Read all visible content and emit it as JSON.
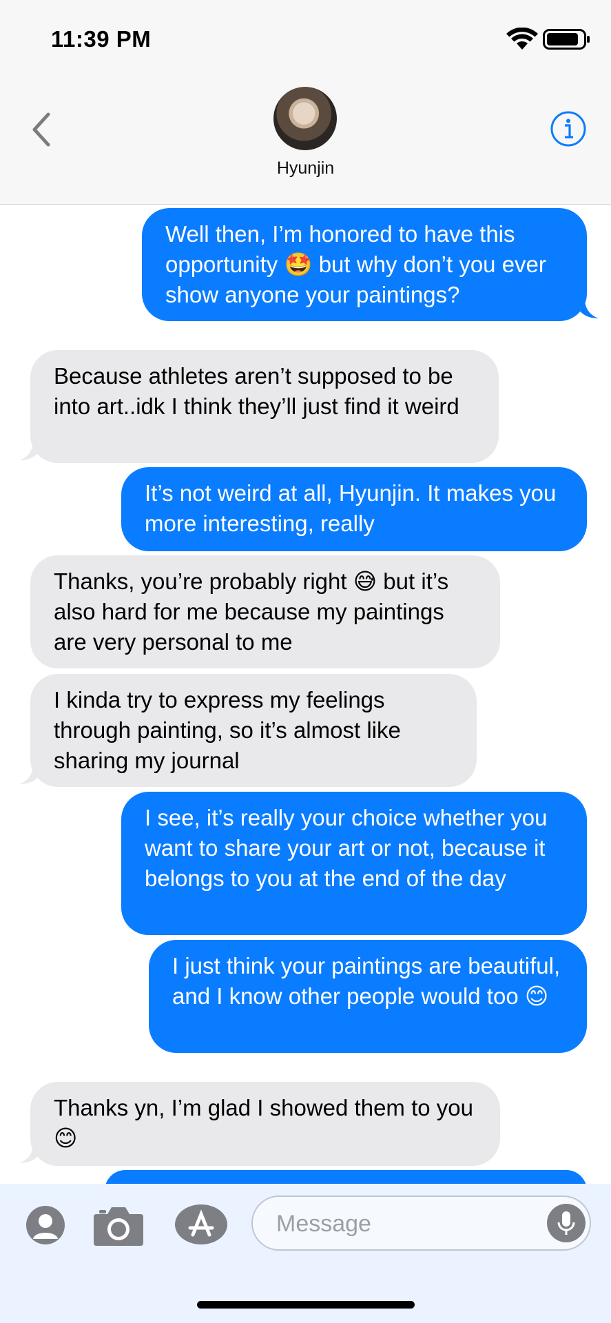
{
  "status_bar": {
    "time": "11:39 PM"
  },
  "header": {
    "contact_name": "Hyunjin"
  },
  "messages": [
    {
      "sender": "me",
      "text": "Well then, I’m honored to have this opportunity 🤩 but why don’t you ever show anyone your paintings?"
    },
    {
      "sender": "them",
      "text": "Because athletes aren’t supposed to be into art..idk I think they’ll just find it weird"
    },
    {
      "sender": "me",
      "text": "It’s not weird at all, Hyunjin. It makes you more interesting, really"
    },
    {
      "sender": "them",
      "text": "Thanks, you’re probably right 😅 but it’s also hard for me because my paintings are very personal to me"
    },
    {
      "sender": "them",
      "text": "I kinda try to express my feelings through painting, so it’s almost like sharing my journal"
    },
    {
      "sender": "me",
      "text": "I see, it’s really your choice whether you want to share your art or not, because it belongs to you at the end of the day"
    },
    {
      "sender": "me",
      "text": "I just think your paintings are beautiful, and I know other people would too 😊"
    },
    {
      "sender": "them",
      "text": "Thanks yn, I’m glad I showed them to you 😊"
    }
  ],
  "input": {
    "placeholder": "Message"
  },
  "icons": {
    "back": "chevron-left-icon",
    "info": "info-icon",
    "memoji": "person-icon",
    "camera": "camera-icon",
    "app_store": "app-store-icon",
    "mic": "microphone-icon"
  },
  "colors": {
    "sent_bubble": "#0a7cff",
    "received_bubble": "#e9e9eb",
    "accent": "#0a7cff"
  }
}
